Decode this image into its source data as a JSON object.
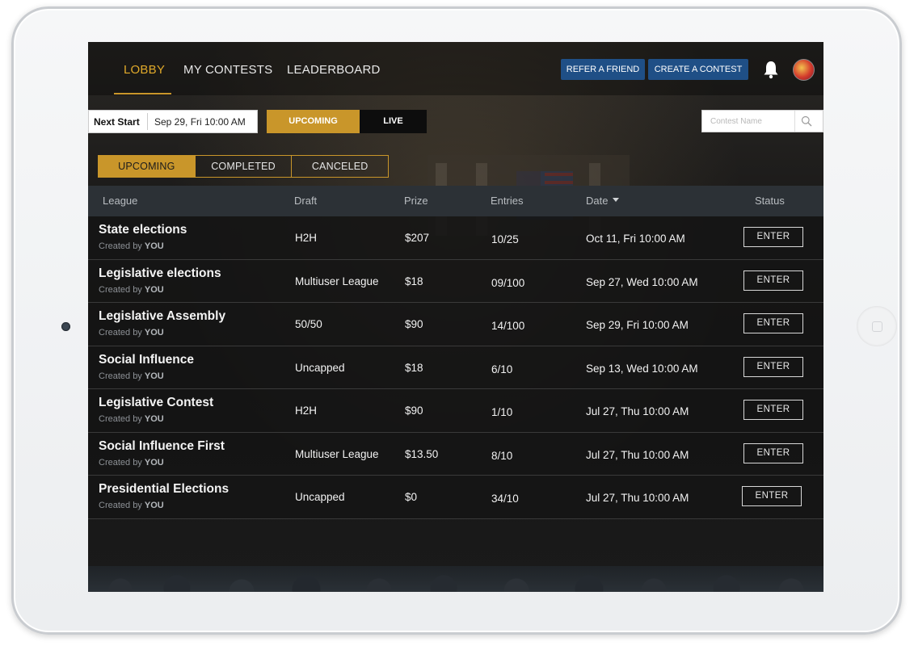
{
  "nav": {
    "tabs": [
      {
        "label": "LOBBY",
        "active": true
      },
      {
        "label": "MY CONTESTS",
        "active": false
      },
      {
        "label": "LEADERBOARD",
        "active": false
      }
    ],
    "refer_label": "REFER A FRIEND",
    "create_label": "CREATE A CONTEST",
    "bell_icon": "bell-icon",
    "avatar_icon": "avatar"
  },
  "filters": {
    "next_start_label": "Next Start",
    "next_start_value": "Sep 29, Fri 10:00 AM",
    "mode_tabs": [
      {
        "label": "UPCOMING",
        "active": true
      },
      {
        "label": "LIVE",
        "active": false
      }
    ],
    "search_placeholder": "Contest Name",
    "search_icon": "search-icon"
  },
  "subtabs": [
    {
      "label": "UPCOMING",
      "active": true
    },
    {
      "label": "COMPLETED",
      "active": false
    },
    {
      "label": "CANCELED",
      "active": false
    }
  ],
  "table": {
    "headers": {
      "league": "League",
      "draft": "Draft",
      "prize": "Prize",
      "entries": "Entries",
      "date": "Date",
      "status": "Status"
    },
    "created_prefix": "Created by",
    "created_owner": "YOU",
    "enter_label": "ENTER",
    "rows": [
      {
        "league": "State elections",
        "draft": "H2H",
        "prize": "$207",
        "entries": "10/25",
        "date": "Oct 11, Fri 10:00 AM"
      },
      {
        "league": "Legislative elections",
        "draft": "Multiuser League",
        "prize": "$18",
        "entries": "09/100",
        "date": "Sep 27, Wed 10:00 AM"
      },
      {
        "league": "Legislative Assembly",
        "draft": "50/50",
        "prize": "$90",
        "entries": "14/100",
        "date": "Sep 29, Fri 10:00 AM"
      },
      {
        "league": "Social Influence",
        "draft": "Uncapped",
        "prize": "$18",
        "entries": "6/10",
        "date": "Sep 13, Wed 10:00 AM"
      },
      {
        "league": "Legislative Contest",
        "draft": "H2H",
        "prize": "$90",
        "entries": "1/10",
        "date": "Jul 27, Thu 10:00 AM"
      },
      {
        "league": "Social Influence First",
        "draft": "Multiuser League",
        "prize": "$13.50",
        "entries": "8/10",
        "date": "Jul 27, Thu 10:00 AM"
      },
      {
        "league": "Presidential Elections",
        "draft": "Uncapped",
        "prize": "$0",
        "entries": "34/10",
        "date": "Jul 27, Thu 10:00 AM"
      }
    ]
  },
  "colors": {
    "accent_gold": "#c9962a",
    "nav_active": "#e0a92a",
    "button_blue": "#1f4f86",
    "header_bg": "#2c3136"
  }
}
